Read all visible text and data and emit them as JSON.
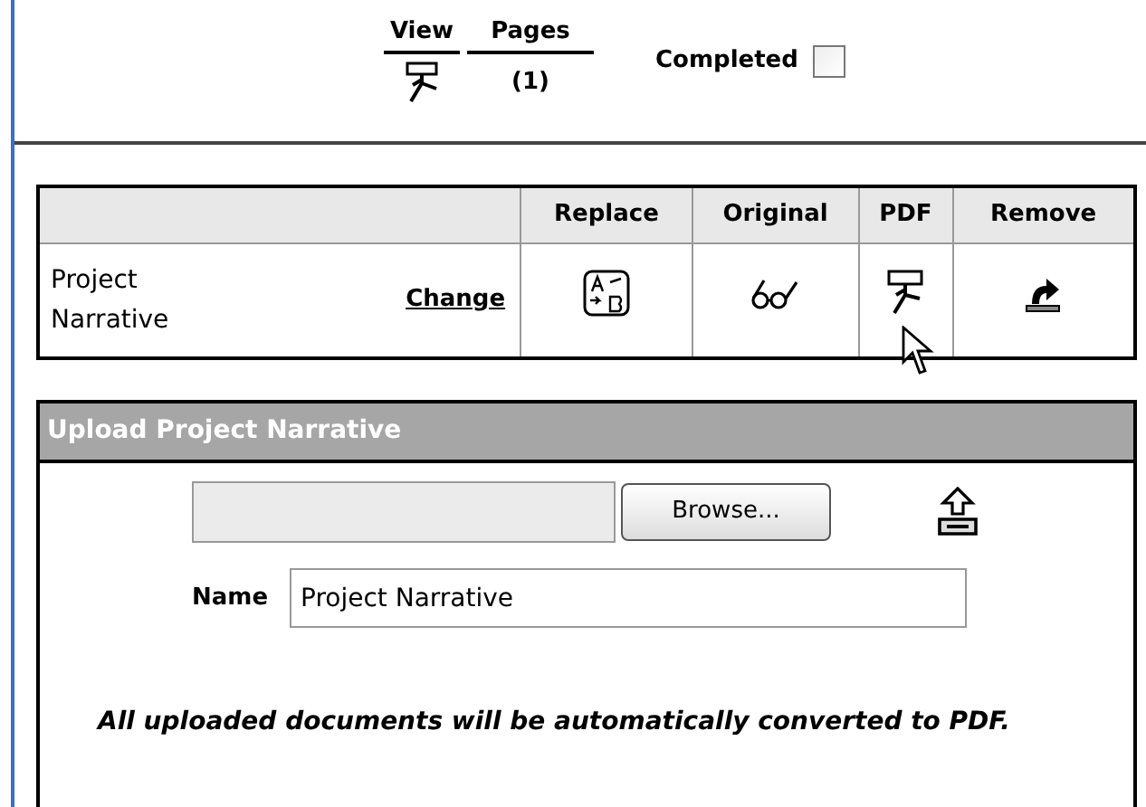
{
  "summary": {
    "view_label": "View",
    "pages_label": "Pages",
    "pages_count": "(1)",
    "completed_label": "Completed",
    "completed": false
  },
  "documents_table": {
    "columns": [
      "",
      "Replace",
      "Original",
      "PDF",
      "Remove"
    ],
    "rows": [
      {
        "name": "Project Narrative",
        "change_link": "Change"
      }
    ]
  },
  "upload_panel": {
    "title": "Upload Project Narrative",
    "browse_button": "Browse...",
    "name_label": "Name",
    "name_value": "Project Narrative",
    "note": "All uploaded documents will be automatically converted to PDF."
  }
}
